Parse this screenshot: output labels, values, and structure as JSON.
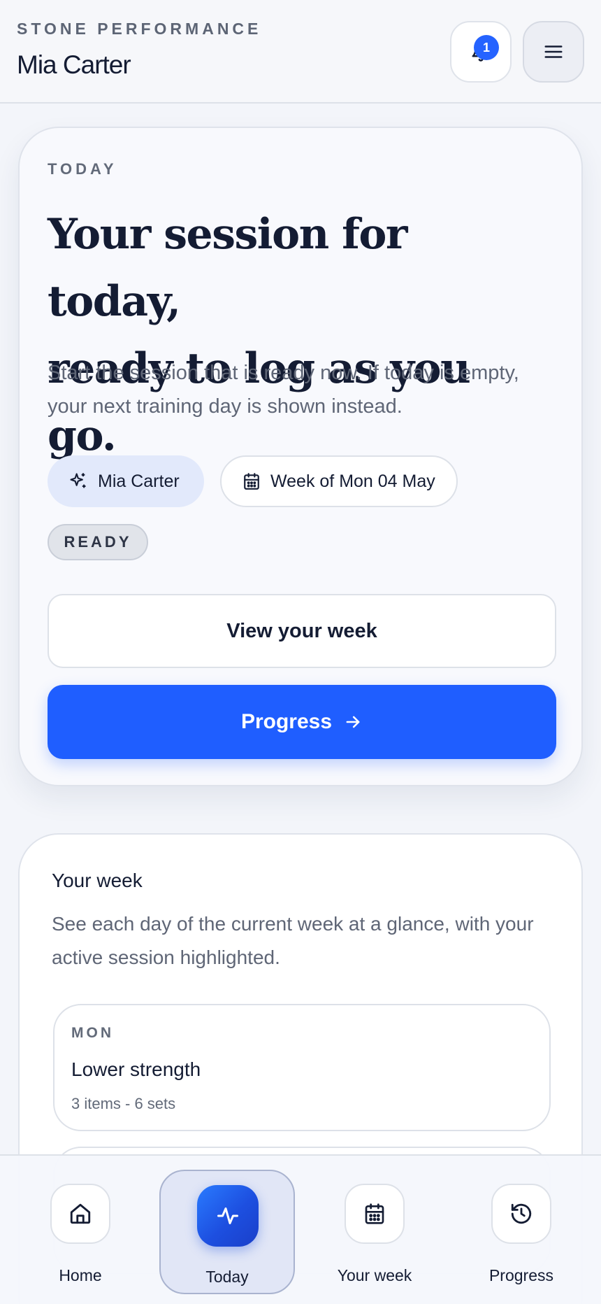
{
  "header": {
    "brand": "STONE PERFORMANCE",
    "user_name": "Mia Carter",
    "notification_count": "1"
  },
  "hero": {
    "eyebrow": "TODAY",
    "title_line1": "Your session for today,",
    "title_line2": "ready to log as you go.",
    "subtitle": "Start the session that is ready now. If today is empty, your next training day is shown instead.",
    "chip_user": "Mia Carter",
    "chip_week": "Week of Mon 04 May",
    "status": "READY",
    "secondary_button": "View your week",
    "primary_button": "Progress"
  },
  "week": {
    "title": "Your week",
    "description": "See each day of the current week at a glance, with your active session highlighted.",
    "days": [
      {
        "label": "MON",
        "session": "Lower strength",
        "meta": "3 items - 6 sets"
      }
    ]
  },
  "nav": {
    "items": [
      {
        "label": "Home",
        "icon": "home-icon"
      },
      {
        "label": "Today",
        "icon": "activity-icon",
        "active": true
      },
      {
        "label": "Your week",
        "icon": "calendar-icon"
      },
      {
        "label": "Progress",
        "icon": "history-icon"
      }
    ]
  },
  "colors": {
    "accent": "#1f5eff",
    "text": "#141c33",
    "muted": "#5f6676"
  }
}
